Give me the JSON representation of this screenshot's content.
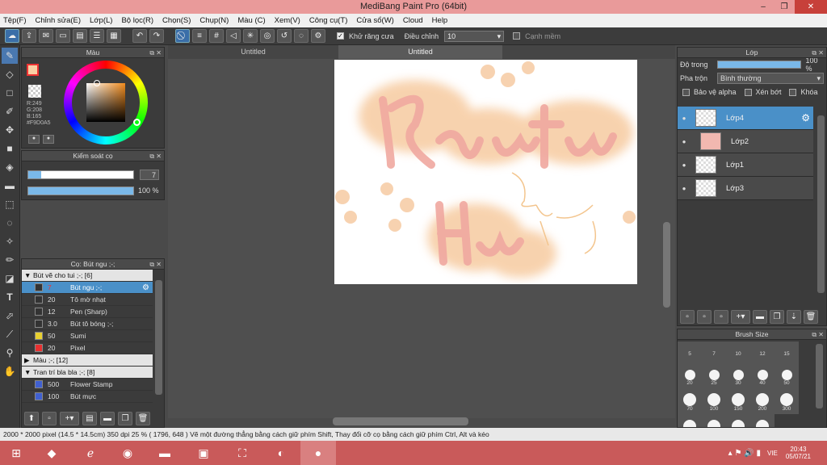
{
  "window": {
    "title": "MediBang Paint Pro (64bit)",
    "controls": [
      "–",
      "❐",
      "✕"
    ]
  },
  "menu": [
    "Tệp(F)",
    "Chỉnh sửa(E)",
    "Lớp(L)",
    "Bộ lọc(R)",
    "Chọn(S)",
    "Chụp(N)",
    "Màu (C)",
    "Xem(V)",
    "Công cụ(T)",
    "Cửa sổ(W)",
    "Cloud",
    "Help"
  ],
  "toolbar": {
    "antialias_label": "Khử răng cưa",
    "adjust_label": "Điều chỉnh",
    "adjust_value": "10",
    "edge_label": "Cạnh mềm"
  },
  "color_panel": {
    "title": "Màu",
    "r": "R:249",
    "g": "G:208",
    "b": "B:165",
    "hex": "#F9D0A5",
    "primary": "#F9D0A5"
  },
  "brush_control": {
    "title": "Kiểm soát cọ",
    "size": "7",
    "opacity": "100 %"
  },
  "brush_panel": {
    "title": "Cọ: Bút ngu ;-;",
    "rows": [
      {
        "type": "grp",
        "arrow": "▼",
        "label": "Bút vẽ cho tui ;-; [6]"
      },
      {
        "type": "sel",
        "size": "7",
        "label": "Bút ngu ;-;",
        "color": "#333"
      },
      {
        "type": "item",
        "size": "20",
        "label": "Tô mờ nhạt",
        "color": "#333"
      },
      {
        "type": "item",
        "size": "12",
        "label": "Pen (Sharp)",
        "color": "#333"
      },
      {
        "type": "item",
        "size": "3.0",
        "label": "Bút tô bóng ;-;",
        "color": "#333"
      },
      {
        "type": "item",
        "size": "50",
        "label": "Sumi",
        "color": "#e8d030"
      },
      {
        "type": "item",
        "size": "20",
        "label": "Pixel",
        "color": "#e83030"
      },
      {
        "type": "grp",
        "arrow": "▶",
        "label": "Màu ;-; [12]"
      },
      {
        "type": "grp",
        "arrow": "▼",
        "label": "Tran trí bla bla ;-; [8]"
      },
      {
        "type": "item",
        "size": "500",
        "label": "Flower Stamp",
        "color": "#4060d0"
      },
      {
        "type": "item",
        "size": "100",
        "label": "Bút mực",
        "color": "#4060d0"
      }
    ]
  },
  "tabs": [
    "Untitled",
    "Untitled"
  ],
  "layer_panel": {
    "title": "Lớp",
    "opacity_label": "Độ trong",
    "opacity_value": "100 %",
    "blend_label": "Pha trộn",
    "blend_value": "Bình thường",
    "protect_alpha": "Bảo vệ alpha",
    "clip": "Xén bớt",
    "lock": "Khóa",
    "layers": [
      {
        "name": "Lớp4",
        "selected": true
      },
      {
        "name": "Lớp2",
        "selected": false
      },
      {
        "name": "Lớp1",
        "selected": false
      },
      {
        "name": "Lớp3",
        "selected": false
      }
    ]
  },
  "brush_size_panel": {
    "title": "Brush Size",
    "sizes": [
      "5",
      "7",
      "10",
      "12",
      "15",
      "20",
      "25",
      "30",
      "40",
      "50",
      "70",
      "100",
      "150",
      "200",
      "300",
      "",
      "",
      "",
      ""
    ]
  },
  "status": {
    "text": "2000 * 2000 pixel   (14.5 * 14.5cm)   350 dpi   25 %   ( 1796, 648 )   Vẽ một đường thẳng bằng cách giữ phím Shift, Thay đổi cỡ cọ bằng cách giữ phím Ctrl, Alt và kéo"
  },
  "taskbar": {
    "lang": "VIE",
    "time": "20:43",
    "date": "05/07/21"
  }
}
